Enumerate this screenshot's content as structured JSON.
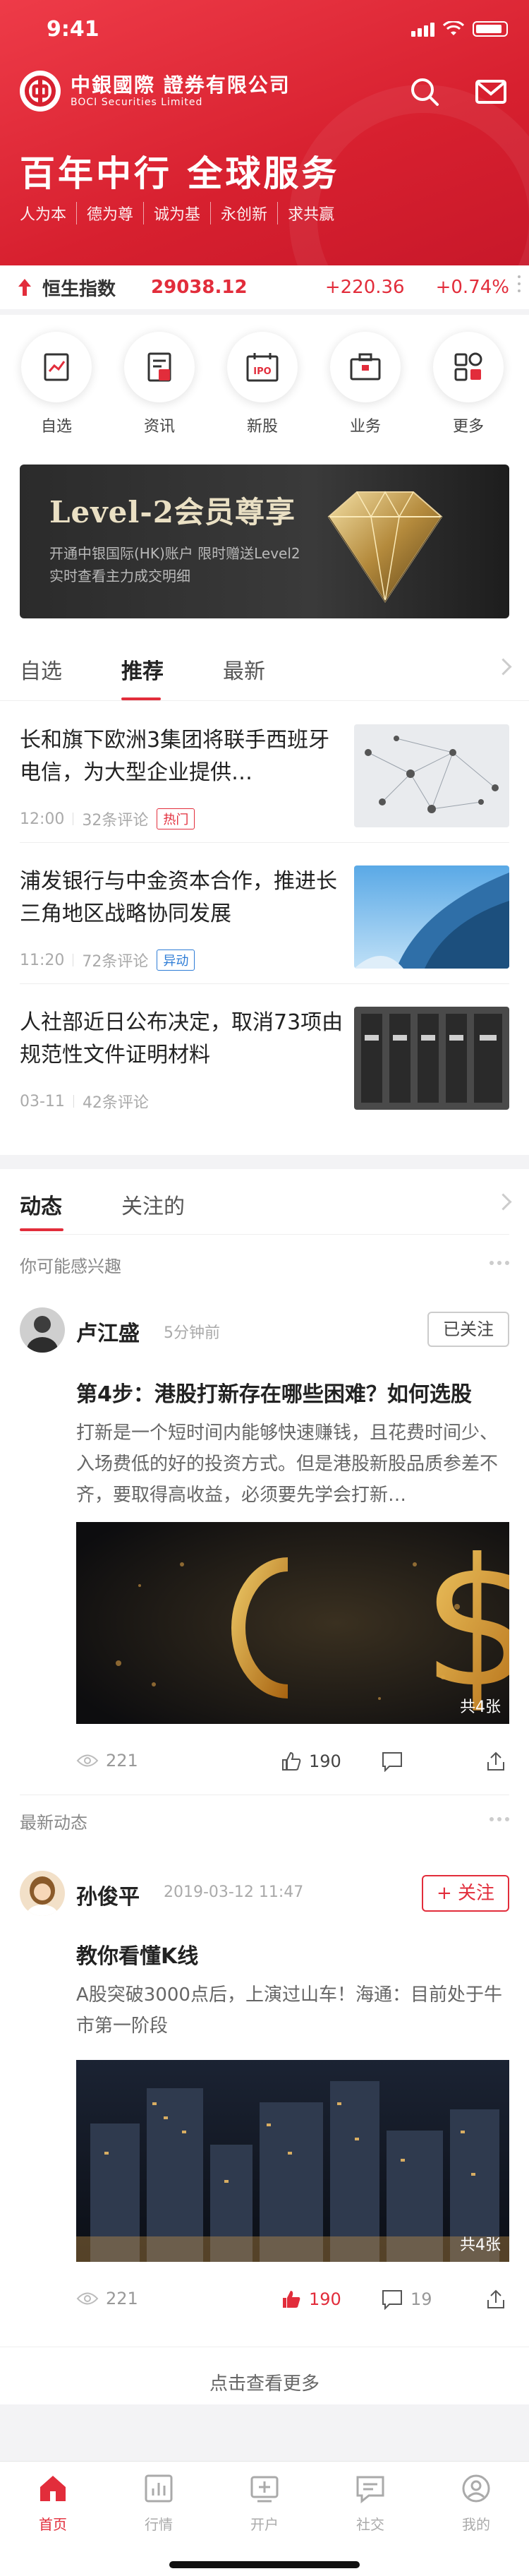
{
  "status_bar": {
    "time": "9:41"
  },
  "header": {
    "logo_cn": "中銀國際 證券有限公司",
    "logo_en": "BOCI Securities Limited",
    "slogan": "百年中行 全球服务",
    "values": [
      "人为本",
      "德为尊",
      "诚为基",
      "永创新",
      "求共赢"
    ]
  },
  "index": {
    "name": "恒生指数",
    "value": "29038.12",
    "change": "+220.36",
    "change_pct": "+0.74%"
  },
  "quick_entries": [
    {
      "label": "自选",
      "icon": "watchlist-icon"
    },
    {
      "label": "资讯",
      "icon": "news-icon"
    },
    {
      "label": "新股",
      "icon": "ipo-icon"
    },
    {
      "label": "业务",
      "icon": "business-icon"
    },
    {
      "label": "更多",
      "icon": "more-grid-icon"
    }
  ],
  "banner": {
    "title": "Level-2会员尊享",
    "line1": "开通中银国际(HK)账户   限时赠送Level2",
    "line2": "实时查看主力成交明细"
  },
  "feed_tabs": [
    "自选",
    "推荐",
    "最新"
  ],
  "news": [
    {
      "title": "长和旗下欧洲3集团将联手西班牙电信，为大型企业提供…",
      "time": "12:00",
      "comments": "32条评论",
      "tag": "热门",
      "tag_type": "hot"
    },
    {
      "title": "浦发银行与中金资本合作，推进长三角地区战略协同发展",
      "time": "11:20",
      "comments": "72条评论",
      "tag": "异动",
      "tag_type": "ipo"
    },
    {
      "title": "人社部近日公布决定，取消73项由规范性文件证明材料",
      "time": "03-11",
      "comments": "42条评论",
      "tag": "",
      "tag_type": ""
    }
  ],
  "social": {
    "tabs": [
      "动态",
      "关注的"
    ],
    "section_interest": "你可能感兴趣",
    "section_latest": "最新动态",
    "see_more": "点击查看更多",
    "posts": [
      {
        "user": "卢江盛",
        "time": "5分钟前",
        "follow_label": "已关注",
        "title": "第4步：港股打新存在哪些困难？如何选股",
        "body": "打新是一个短时间内能够快速赚钱，且花费时间少、入场费低的好的投资方式。但是港股新股品质参差不齐，要取得高收益，必须要先学会打新…",
        "img_count": "共4张",
        "views": "221",
        "likes": "190",
        "comments": ""
      },
      {
        "user": "孙俊平",
        "time": "2019-03-12 11:47",
        "follow_label": "+ 关注",
        "title": "教你看懂K线",
        "body": "A股突破3000点后，上演过山车！海通：目前处于牛市第一阶段",
        "img_count": "共4张",
        "views": "221",
        "likes": "190",
        "comments": "19"
      }
    ]
  },
  "bottom_nav": [
    {
      "label": "首页",
      "active": true
    },
    {
      "label": "行情",
      "active": false
    },
    {
      "label": "开户",
      "active": false
    },
    {
      "label": "社交",
      "active": false
    },
    {
      "label": "我的",
      "active": false
    }
  ],
  "colors": {
    "brand": "#e22d3b",
    "blue_tag": "#2d7cd6"
  }
}
